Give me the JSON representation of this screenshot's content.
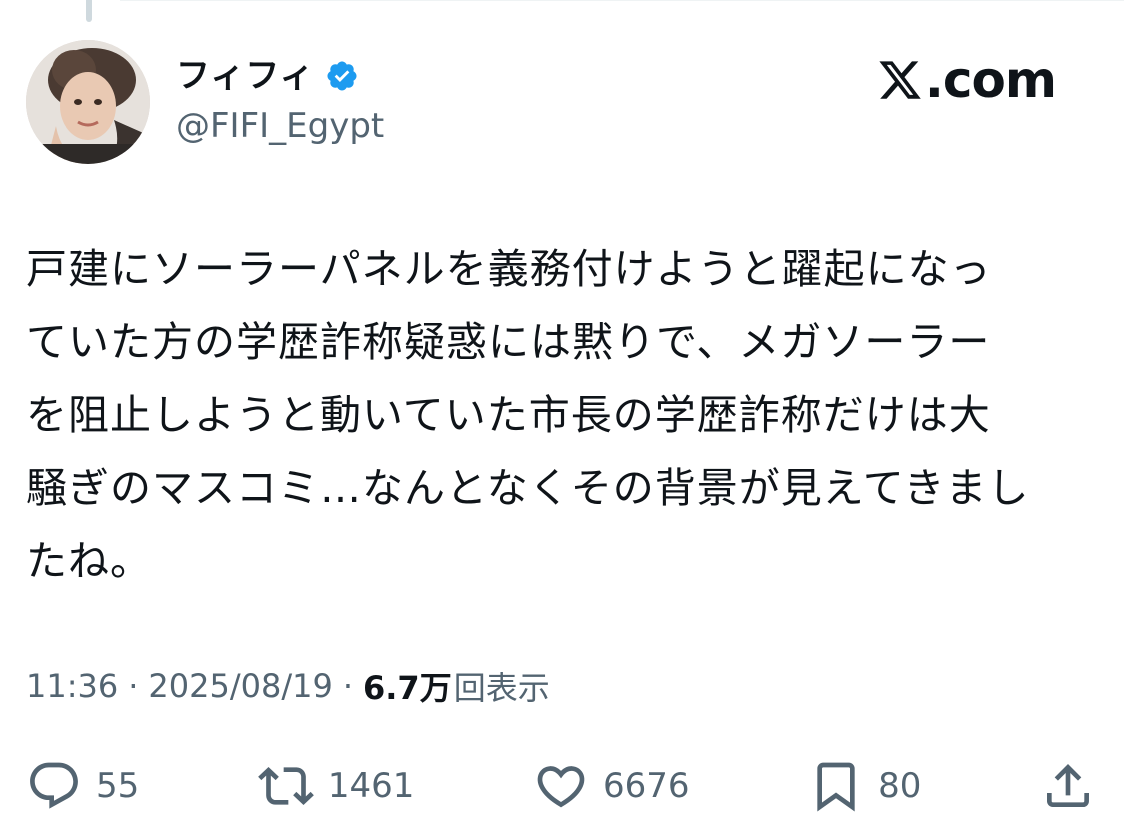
{
  "author": {
    "display_name": "フィフィ",
    "handle": "@FIFI_Egypt",
    "verified": true
  },
  "brand": {
    "text": ".com",
    "icon": "x-logo-icon"
  },
  "tweet": {
    "lines": [
      "戸建にソーラーパネルを義務付けようと躍起になっ",
      "ていた方の学歴詐称疑惑には黙りで、メガソーラー",
      "を阻止しようと動いていた市長の学歴詐称だけは大",
      "騒ぎのマスコミ…なんとなくその背景が見えてきまし",
      "たね。"
    ]
  },
  "meta": {
    "time": "11:36",
    "separator": "·",
    "date": "2025/08/19",
    "views_count": "6.7万",
    "views_label": "回表示"
  },
  "actions": {
    "replies": "55",
    "reposts": "1461",
    "likes": "6676",
    "bookmarks": "80"
  },
  "colors": {
    "text": "#0f1419",
    "secondary": "#536471",
    "verified": "#1d9bf0",
    "background": "#ffffff"
  }
}
